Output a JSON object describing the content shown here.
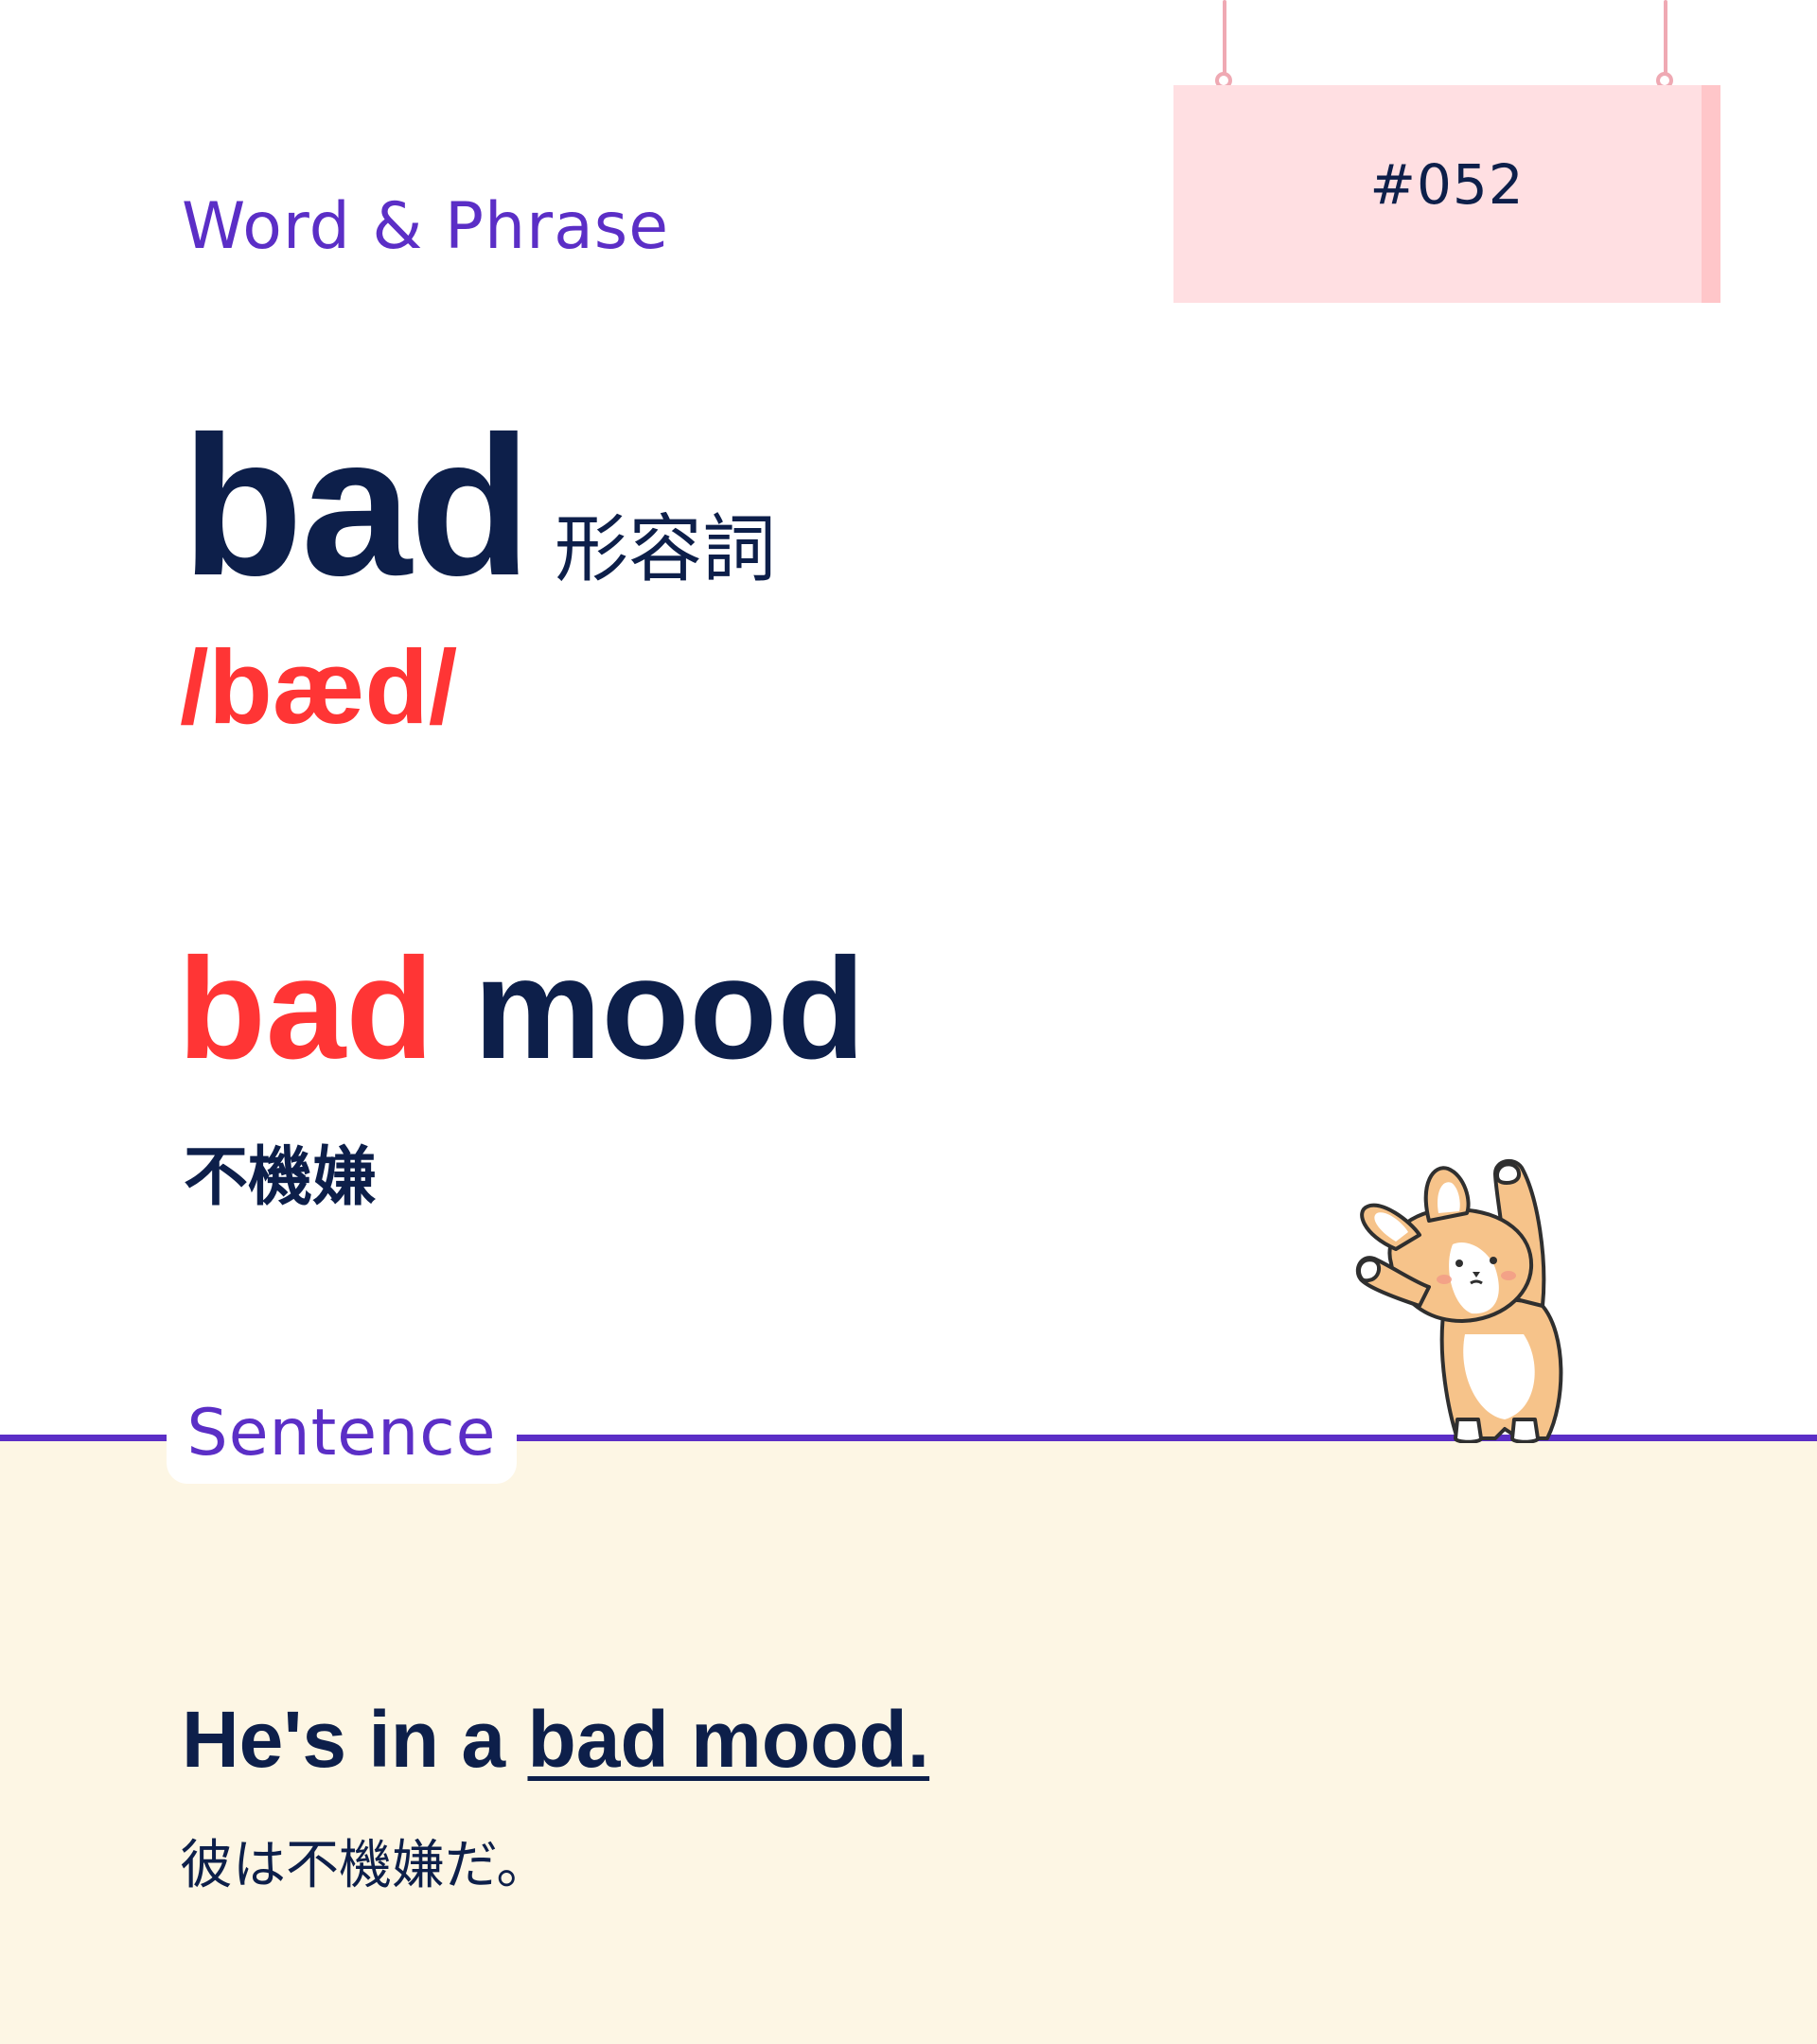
{
  "header": {
    "section_label": "Word & Phrase",
    "card_number": "#052"
  },
  "word": {
    "headword": "bad",
    "part_of_speech": "形容詞",
    "phonetic": "/bæd/"
  },
  "phrase": {
    "highlight": "bad",
    "rest": "mood",
    "translation": "不機嫌"
  },
  "sentence": {
    "label": "Sentence",
    "prefix": "He's in a",
    "underlined": "bad mood.",
    "translation": "彼は不機嫌だ。"
  },
  "colors": {
    "accent_purple": "#5b2ec6",
    "highlight_red": "#ff3535",
    "navy_text": "#0d1f4a",
    "sign_pink": "#ffdfe2",
    "sentence_bg": "#fdf6e4"
  },
  "icons": {
    "mascot": "corgi-mascot-icon",
    "sign": "hanging-sign-icon"
  }
}
